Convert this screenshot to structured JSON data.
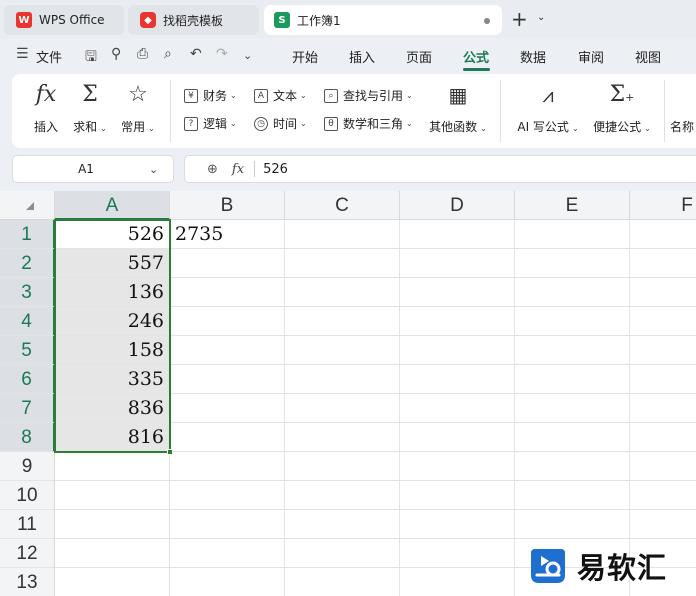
{
  "tabs": [
    {
      "label": "WPS Office",
      "icon": "wps-logo-icon",
      "color": "#e8352f"
    },
    {
      "label": "找稻壳模板",
      "icon": "daoke-icon",
      "color": "#e8352f"
    },
    {
      "label": "工作簿1",
      "icon": "spreadsheet-icon",
      "color": "#1d9a5b",
      "active": true
    }
  ],
  "menu": {
    "file": "文件",
    "items": [
      "开始",
      "插入",
      "页面",
      "公式",
      "数据",
      "审阅",
      "视图"
    ],
    "active": "公式",
    "accent": "#1c7a52"
  },
  "ribbon": {
    "big": [
      {
        "label": "插入",
        "icon": "fx-icon"
      },
      {
        "label": "求和",
        "icon": "sigma-icon"
      },
      {
        "label": "常用",
        "icon": "star-icon"
      }
    ],
    "small": [
      {
        "label": "财务",
        "icon": "finance-icon"
      },
      {
        "label": "文本",
        "icon": "text-icon"
      },
      {
        "label": "查找与引用",
        "icon": "lookup-icon"
      },
      {
        "label": "逻辑",
        "icon": "logic-icon"
      },
      {
        "label": "时间",
        "icon": "clock-icon"
      },
      {
        "label": "数学和三角",
        "icon": "math-icon"
      }
    ],
    "other_functions": "其他函数",
    "ai_formula": "AI 写公式",
    "quick_formula": "便捷公式",
    "name_partial": "名称"
  },
  "formula_bar": {
    "cell_ref": "A1",
    "fx_label": "fx",
    "value": "526"
  },
  "sheet": {
    "columns": [
      "A",
      "B",
      "C",
      "D",
      "E",
      "F"
    ],
    "rows": [
      "1",
      "2",
      "3",
      "4",
      "5",
      "6",
      "7",
      "8",
      "9",
      "10",
      "11",
      "12",
      "13"
    ],
    "column_a": [
      "526",
      "557",
      "136",
      "246",
      "158",
      "335",
      "836",
      "816"
    ],
    "b1": "2735",
    "selection": "A1:A8",
    "selection_color": "#2e7d32"
  },
  "watermark": {
    "text": "易软汇"
  }
}
